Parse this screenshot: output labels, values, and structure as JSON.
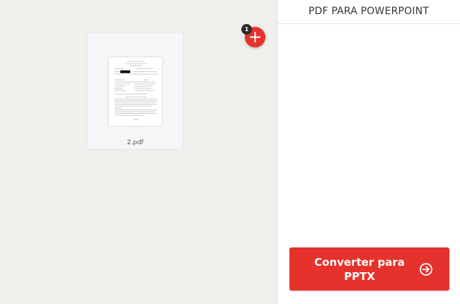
{
  "workspace": {
    "files": [
      {
        "name": "2.pdf"
      }
    ],
    "add_button": {
      "icon": "plus-icon",
      "badge_count": "1"
    }
  },
  "sidebar": {
    "title": "PDF PARA POWERPOINT",
    "convert_button": {
      "label": "Converter para PPTX",
      "icon": "arrow-right-circle-icon"
    }
  },
  "colors": {
    "accent": "#e5322d",
    "workspace_bg": "#f0efec",
    "sidebar_bg": "#ffffff",
    "badge_bg": "#2a2a2a"
  }
}
